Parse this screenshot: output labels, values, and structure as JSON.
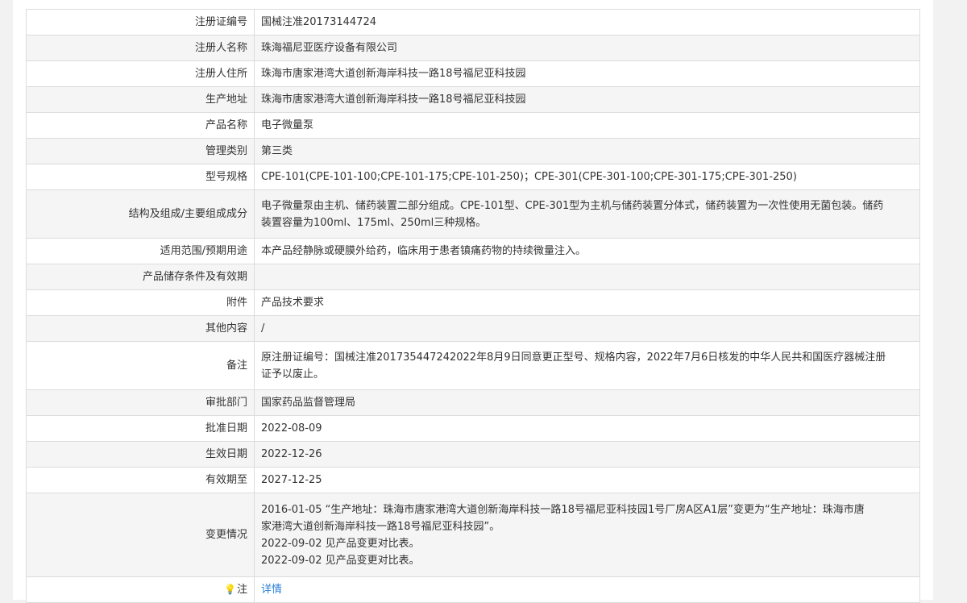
{
  "rows": [
    {
      "label": "注册证编号",
      "value": "国械注准20173144724"
    },
    {
      "label": "注册人名称",
      "value": "珠海福尼亚医疗设备有限公司"
    },
    {
      "label": "注册人住所",
      "value": "珠海市唐家港湾大道创新海岸科技一路18号福尼亚科技园"
    },
    {
      "label": "生产地址",
      "value": "珠海市唐家港湾大道创新海岸科技一路18号福尼亚科技园"
    },
    {
      "label": "产品名称",
      "value": "电子微量泵"
    },
    {
      "label": "管理类别",
      "value": "第三类"
    },
    {
      "label": "型号规格",
      "value": "CPE-101(CPE-101-100;CPE-101-175;CPE-101-250)；CPE-301(CPE-301-100;CPE-301-175;CPE-301-250)"
    },
    {
      "label": "结构及组成/主要组成成分",
      "value_lines": [
        "电子微量泵由主机、储药装置二部分组成。CPE-101型、CPE-301型为主机与储药装置分体式，储药装置为一次性使用无菌包装。储药",
        "装置容量为100ml、175ml、250ml三种规格。"
      ]
    },
    {
      "label": "适用范围/预期用途",
      "value": "本产品经静脉或硬膜外给药，临床用于患者镇痛药物的持续微量注入。"
    },
    {
      "label": "产品储存条件及有效期",
      "value": ""
    },
    {
      "label": "附件",
      "value": "产品技术要求"
    },
    {
      "label": "其他内容",
      "value": "/"
    },
    {
      "label": "备注",
      "value_lines": [
        "原注册证编号：国械注准201735447242022年8月9日同意更正型号、规格内容，2022年7月6日核发的中华人民共和国医疗器械注册",
        "证予以废止。"
      ]
    },
    {
      "label": "审批部门",
      "value": "国家药品监督管理局"
    },
    {
      "label": "批准日期",
      "value": "2022-08-09"
    },
    {
      "label": "生效日期",
      "value": "2022-12-26"
    },
    {
      "label": "有效期至",
      "value": "2027-12-25"
    },
    {
      "label": "变更情况",
      "value_lines": [
        "2016-01-05 “生产地址：珠海市唐家港湾大道创新海岸科技一路18号福尼亚科技园1号厂房A区A1层”变更为“生产地址：珠海市唐",
        "家港湾大道创新海岸科技一路18号福尼亚科技园”。",
        "2022-09-02 见产品变更对比表。",
        "2022-09-02 见产品变更对比表。"
      ]
    },
    {
      "label": "注",
      "icon": "lightbulb-icon",
      "icon_glyph": "💡",
      "link_text": "详情"
    }
  ]
}
